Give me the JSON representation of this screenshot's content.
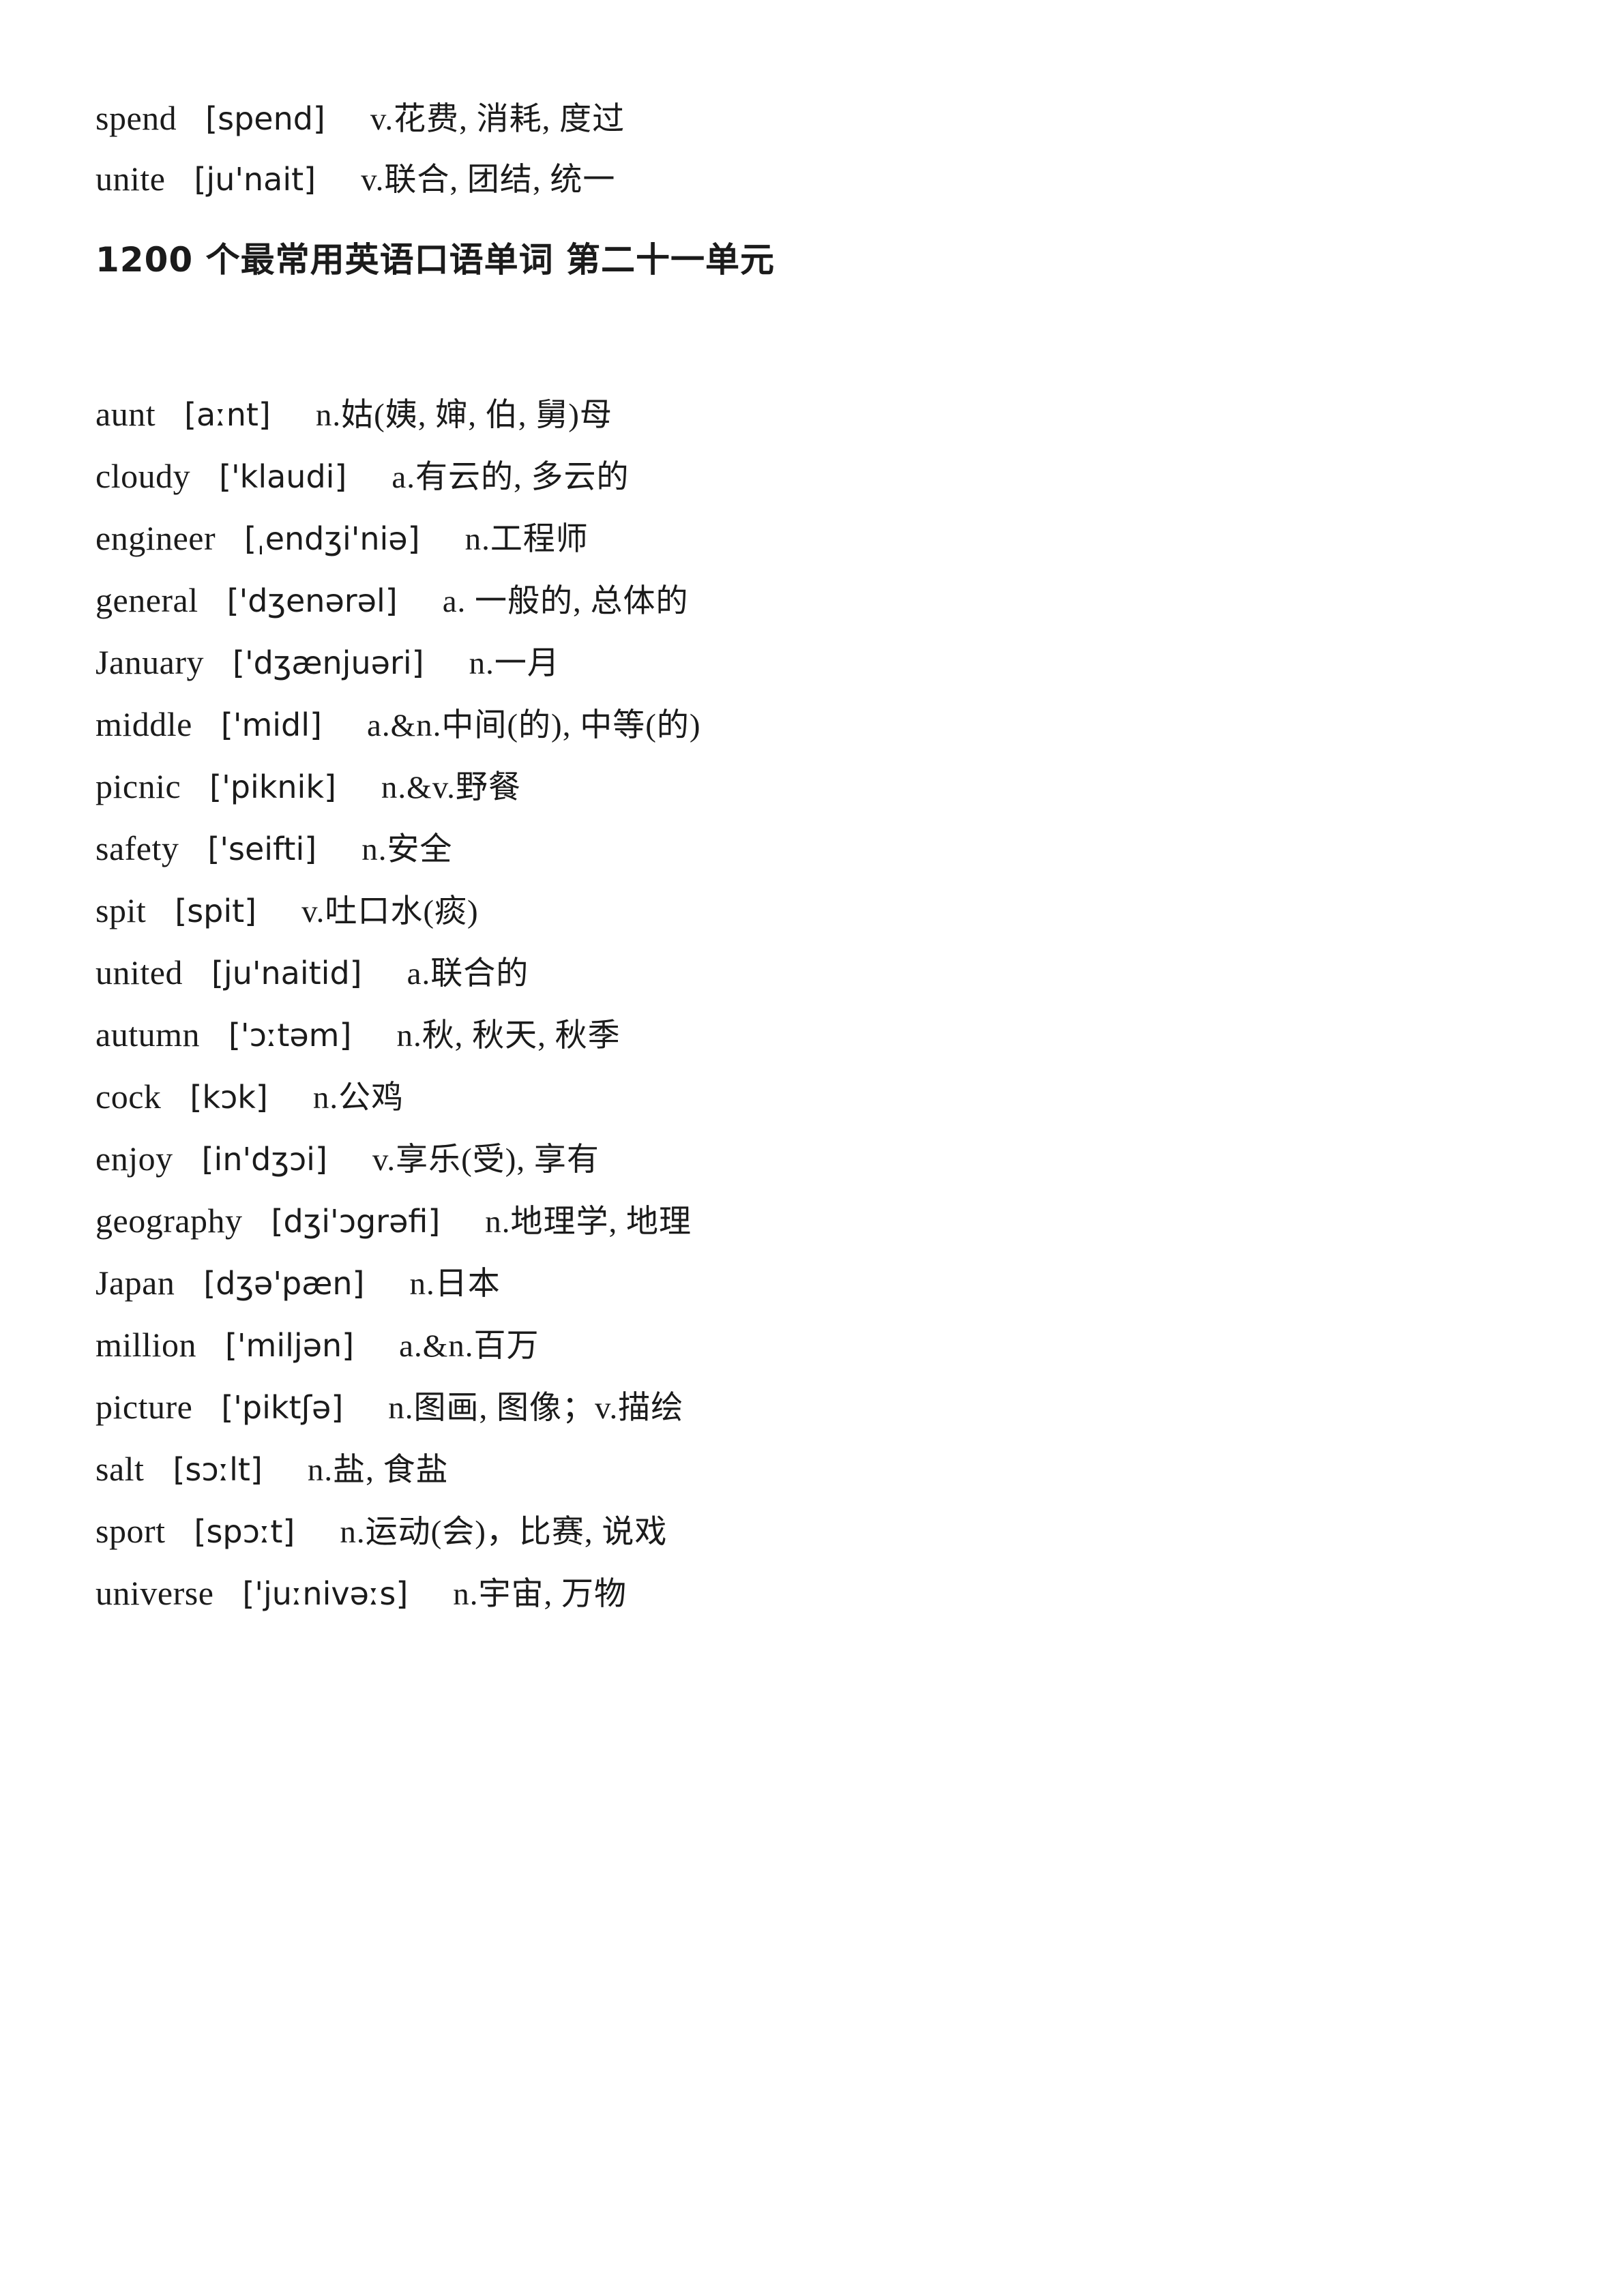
{
  "document": {
    "title": "1200 个最常用英语口语单词 第二十一单元"
  },
  "lead_entries": [
    {
      "word": "spend",
      "phonetic": "[spend]",
      "definition": "v.花费, 消耗, 度过"
    },
    {
      "word": "unite",
      "phonetic": "[ju'nait]",
      "definition": "v.联合, 团结, 统一"
    }
  ],
  "section_heading": "1200 个最常用英语口语单词 第二十一单元",
  "word_list": [
    {
      "word": "aunt",
      "phonetic": "[aːnt]",
      "definition": "n.姑(姨, 婶, 伯, 舅)母"
    },
    {
      "word": "cloudy",
      "phonetic": "['klaudi]",
      "definition": "a.有云的, 多云的"
    },
    {
      "word": "engineer",
      "phonetic": "[ˌendʒi'niə]",
      "definition": "n.工程师"
    },
    {
      "word": "general",
      "phonetic": "['dʒenərəl]",
      "definition": "a. 一般的, 总体的"
    },
    {
      "word": "January",
      "phonetic": "['dʒænjuəri]",
      "definition": "n.一月"
    },
    {
      "word": "middle",
      "phonetic": "['midl]",
      "definition": "a.&n.中间(的), 中等(的)"
    },
    {
      "word": "picnic",
      "phonetic": "['piknik]",
      "definition": "n.&v.野餐"
    },
    {
      "word": "safety",
      "phonetic": "['seifti]",
      "definition": "n.安全"
    },
    {
      "word": "spit",
      "phonetic": "[spit]",
      "definition": "v.吐口水(痰)"
    },
    {
      "word": "united",
      "phonetic": "[ju'naitid]",
      "definition": "a.联合的"
    },
    {
      "word": "autumn",
      "phonetic": "['ɔːtəm]",
      "definition": "n.秋, 秋天, 秋季"
    },
    {
      "word": "cock",
      "phonetic": "[kɔk]",
      "definition": "n.公鸡"
    },
    {
      "word": "enjoy",
      "phonetic": "[in'dʒɔi]",
      "definition": "v.享乐(受), 享有"
    },
    {
      "word": "geography",
      "phonetic": "[dʒi'ɔgrəfi]",
      "definition": "n.地理学, 地理"
    },
    {
      "word": "Japan",
      "phonetic": "[dʒə'pæn]",
      "definition": "n.日本"
    },
    {
      "word": "million",
      "phonetic": "['miljən]",
      "definition": "a.&n.百万"
    },
    {
      "word": "picture",
      "phonetic": "['piktʃə]",
      "definition": "n.图画, 图像；v.描绘"
    },
    {
      "word": "salt",
      "phonetic": "[sɔːlt]",
      "definition": "n.盐, 食盐"
    },
    {
      "word": "sport",
      "phonetic": "[spɔːt]",
      "definition": "n.运动(会)，比赛, 说戏"
    },
    {
      "word": "universe",
      "phonetic": "['juːnivəːs]",
      "definition": "n.宇宙, 万物"
    }
  ]
}
